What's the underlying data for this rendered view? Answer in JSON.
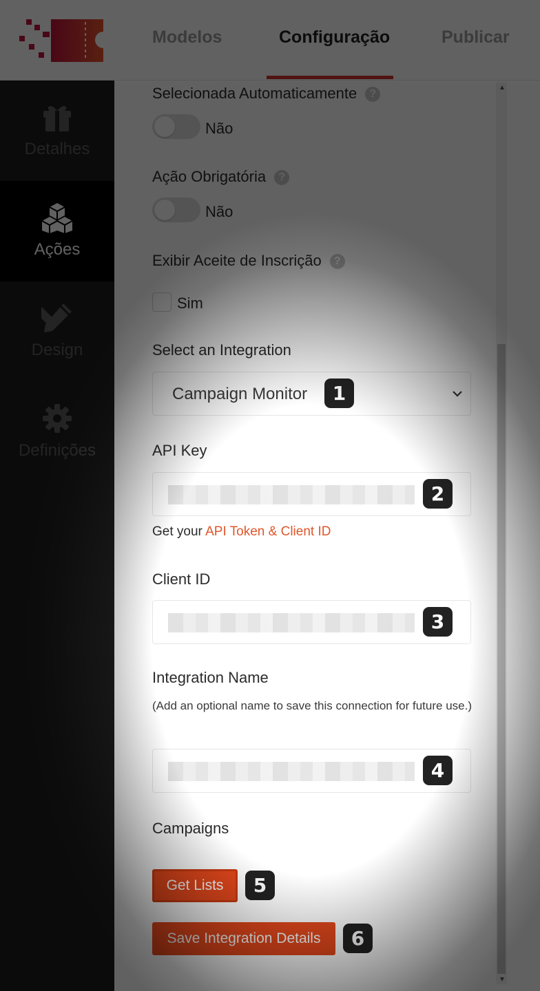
{
  "header": {
    "tabs": [
      {
        "label": "Modelos",
        "active": false
      },
      {
        "label": "Configuração",
        "active": true
      },
      {
        "label": "Publicar",
        "active": false
      }
    ],
    "accent_color": "#d1322e"
  },
  "sidebar": {
    "items": [
      {
        "label": "Detalhes",
        "icon": "gift-icon",
        "active": false
      },
      {
        "label": "Ações",
        "icon": "boxes-icon",
        "active": true
      },
      {
        "label": "Design",
        "icon": "design-tools-icon",
        "active": false
      },
      {
        "label": "Definições",
        "icon": "gear-icon",
        "active": false
      }
    ]
  },
  "form": {
    "auto_selected": {
      "label": "Selecionada Automaticamente",
      "value_text": "Não",
      "enabled": false
    },
    "required_action": {
      "label": "Ação Obrigatória",
      "value_text": "Não",
      "enabled": false
    },
    "show_opt_in": {
      "label": "Exibir Aceite de Inscrição",
      "checkbox_text": "Sim",
      "checked": false
    },
    "integration": {
      "label": "Select an Integration",
      "selected": "Campaign Monitor",
      "badge": "1"
    },
    "api_key": {
      "label": "API Key",
      "badge": "2"
    },
    "api_hint": {
      "prefix": "Get your ",
      "link_text": "API Token & Client ID"
    },
    "client_id": {
      "label": "Client ID",
      "badge": "3"
    },
    "integration_name": {
      "label": "Integration Name",
      "note": "(Add an optional name to save this connection for future use.)",
      "badge": "4"
    },
    "campaigns": {
      "label": "Campaigns"
    },
    "get_lists": {
      "label": "Get Lists",
      "badge": "5"
    },
    "save": {
      "label": "Save Integration Details",
      "badge": "6"
    }
  },
  "colors": {
    "button": "#e4481c",
    "link": "#e0552a",
    "sidebar_bg": "#1d1d1d"
  }
}
